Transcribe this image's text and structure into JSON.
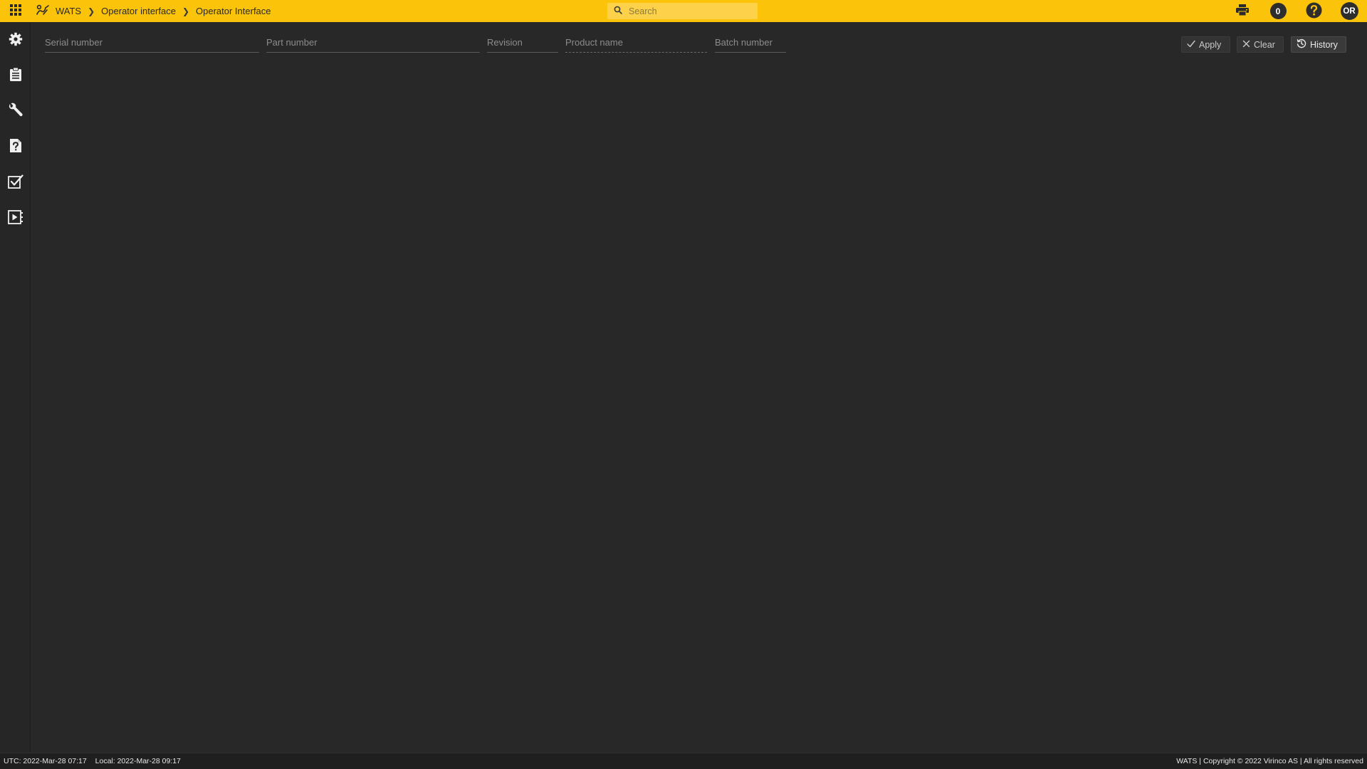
{
  "topbar": {
    "brand": "WATS",
    "breadcrumbs": [
      "Operator interface",
      "Operator Interface"
    ],
    "search_placeholder": "Search",
    "notification_count": "0",
    "user_initials": "OR",
    "icons": [
      "apps-grid-icon",
      "wats-logo-icon",
      "search-icon",
      "printer-icon",
      "help-icon"
    ]
  },
  "sidebar": {
    "items": [
      {
        "icon": "gear-icon"
      },
      {
        "icon": "clipboard-icon"
      },
      {
        "icon": "wrench-icon"
      },
      {
        "icon": "document-question-icon"
      },
      {
        "icon": "checkbox-list-icon"
      },
      {
        "icon": "play-video-icon"
      }
    ]
  },
  "filters": {
    "serial_placeholder": "Serial number",
    "part_placeholder": "Part number",
    "revision_placeholder": "Revision",
    "product_placeholder": "Product name",
    "batch_placeholder": "Batch number"
  },
  "actions": {
    "apply_label": "Apply",
    "clear_label": "Clear",
    "history_label": "History"
  },
  "footer": {
    "utc": "UTC: 2022-Mar-28 07:17",
    "local": "Local: 2022-Mar-28 09:17",
    "copyright": "WATS | Copyright © 2022 Virinco AS | All rights reserved"
  },
  "colors": {
    "accent": "#fbc30a",
    "background": "#282828",
    "sidebar": "#262626"
  }
}
